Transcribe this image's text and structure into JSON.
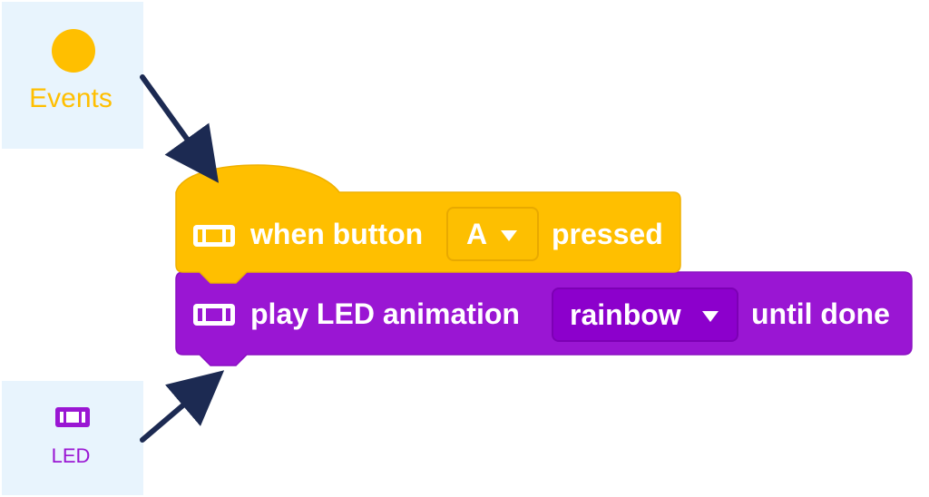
{
  "categories": {
    "events": {
      "label": "Events",
      "color": "#ffbf00",
      "icon": "yellow-circle-icon"
    },
    "led": {
      "label": "LED",
      "color": "#9a16d3",
      "icon": "led-strip-icon"
    }
  },
  "blocks": {
    "event_block": {
      "prefix": "when button",
      "dropdown_value": "A",
      "suffix": "pressed",
      "color": "#ffbf00",
      "icon": "led-strip-icon"
    },
    "led_block": {
      "prefix": "play LED animation",
      "dropdown_value": "rainbow",
      "suffix": "until done",
      "color": "#9a16d3",
      "icon": "led-strip-icon"
    }
  },
  "annotations": {
    "arrow_color": "#1c2a52"
  }
}
